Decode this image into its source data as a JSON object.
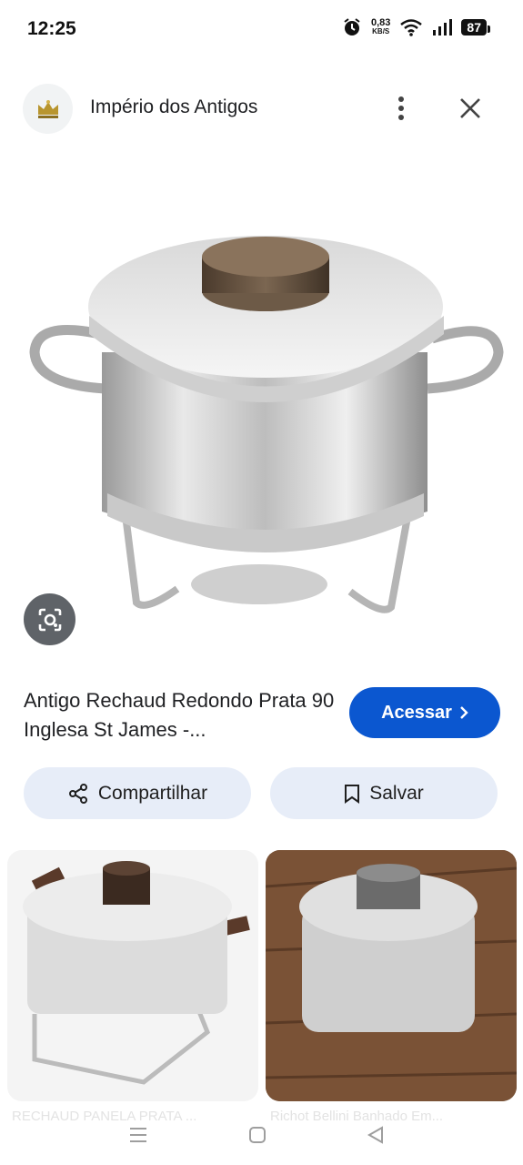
{
  "status_bar": {
    "time": "12:25",
    "net_speed_value": "0,83",
    "net_speed_unit": "KB/S",
    "battery": "87",
    "icons": [
      "alarm-icon",
      "wifi-icon",
      "signal-icon",
      "battery-icon"
    ]
  },
  "header": {
    "site_name": "Império dos Antigos",
    "logo_icon": "crown-icon",
    "menu_icon": "more-vert-icon",
    "close_icon": "close-icon"
  },
  "result": {
    "title": "Antigo Rechaud Redondo Prata 90 Inglesa St James -...",
    "access_label": "Acessar",
    "share_label": "Compartilhar",
    "save_label": "Salvar"
  },
  "related": [
    {
      "caption": "RECHAUD PANELA PRATA ..."
    },
    {
      "caption": "Richot Bellini Banhado Em..."
    }
  ],
  "colors": {
    "accent": "#0b57d0",
    "pill_bg": "#e7edf8",
    "lens_bg": "#5f6368"
  }
}
